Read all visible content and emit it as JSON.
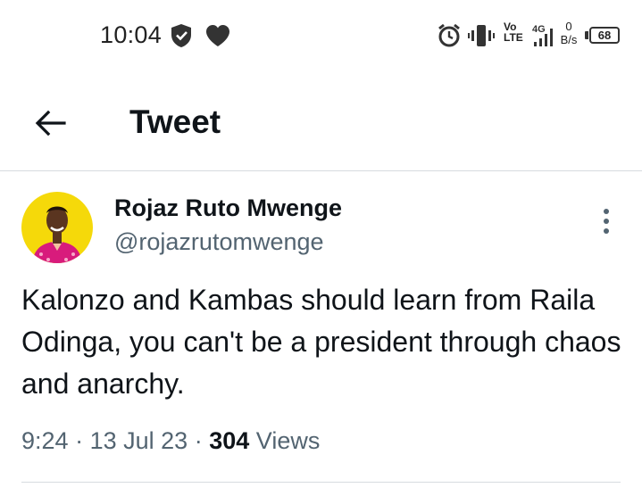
{
  "status_bar": {
    "time": "10:04",
    "volte_top": "Vo",
    "volte_bottom": "LTE",
    "network": "4G",
    "speed_value": "0",
    "speed_unit": "B/s",
    "battery": "68"
  },
  "header": {
    "title": "Tweet",
    "back_icon": "arrow-left-icon"
  },
  "tweet": {
    "display_name": "Rojaz Ruto Mwenge",
    "handle": "@rojazrutomwenge",
    "text": "Kalonzo and Kambas should learn from Raila Odinga, you can't be a president through chaos and anarchy.",
    "time": "9:24",
    "date": "13 Jul 23",
    "separator": "·",
    "views_count": "304",
    "views_label": "Views"
  },
  "colors": {
    "primary_text": "#0f1419",
    "secondary_text": "#536471",
    "divider": "#d7dbdf",
    "avatar_bg": "#f5d90a",
    "avatar_shirt": "#d81b7c"
  }
}
